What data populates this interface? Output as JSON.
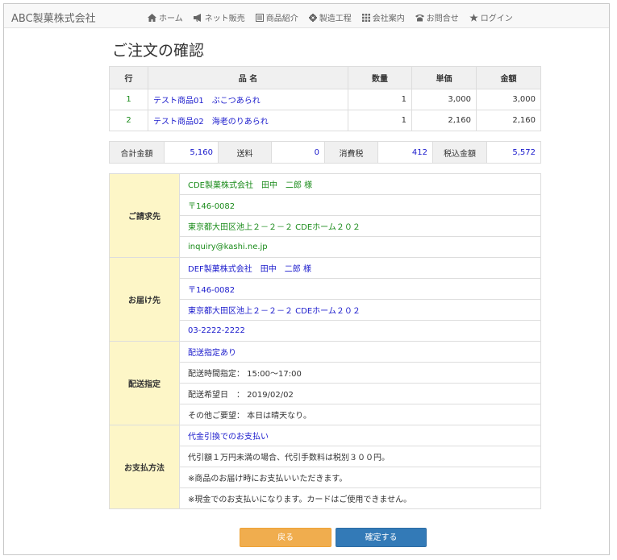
{
  "colors": {
    "accent_blue": "#337ab7",
    "accent_orange": "#f0ad4e",
    "label_bg": "#fdf6c7",
    "green_text": "#1a8b1a",
    "blue_text": "#1a1acc"
  },
  "header": {
    "brand": "ABC製菓株式会社",
    "nav": [
      {
        "icon": "home-icon",
        "label": "ホーム"
      },
      {
        "icon": "bullhorn-icon",
        "label": "ネット販売"
      },
      {
        "icon": "list-icon",
        "label": "商品紹介"
      },
      {
        "icon": "gear-icon",
        "label": "製造工程"
      },
      {
        "icon": "grid-icon",
        "label": "会社案内"
      },
      {
        "icon": "phone-icon",
        "label": "お問合せ"
      },
      {
        "icon": "star-icon",
        "label": "ログイン"
      }
    ]
  },
  "page": {
    "title": "ご注文の確認"
  },
  "items_table": {
    "headers": [
      "行",
      "品 名",
      "数量",
      "単価",
      "金額"
    ],
    "rows": [
      {
        "no": "1",
        "name": "テスト商品01　ぶこつあられ",
        "qty": "1",
        "price": "3,000",
        "amount": "3,000"
      },
      {
        "no": "2",
        "name": "テスト商品02　海老のりあられ",
        "qty": "1",
        "price": "2,160",
        "amount": "2,160"
      }
    ]
  },
  "totals": {
    "subtotal_label": "合計金額",
    "subtotal": "5,160",
    "shipping_label": "送料",
    "shipping": "0",
    "tax_label": "消費税",
    "tax": "412",
    "total_label": "税込金額",
    "total": "5,572"
  },
  "billing": {
    "label": "ご請求先",
    "company": "CDE製菓株式会社　田中　二郎 様",
    "zip": "〒146-0082",
    "address": "東京都大田区池上２－２－２ CDEホーム２０２",
    "email": "inquiry@kashi.ne.jp"
  },
  "delivery": {
    "label": "お届け先",
    "company": "DEF製菓株式会社　田中　二郎 様",
    "zip": "〒146-0082",
    "address": "東京都大田区池上２－２－２ CDEホーム２０２",
    "phone": "03-2222-2222"
  },
  "shipping_spec": {
    "label": "配送指定",
    "status": "配送指定あり",
    "time": "配送時間指定： 15:00～17:00",
    "date": "配送希望日　： 2019/02/02",
    "notes": "その他ご要望： 本日は晴天なり。"
  },
  "payment": {
    "label": "お支払方法",
    "method": "代金引換でのお支払い",
    "line1": "代引額１万円未満の場合、代引手数料は税別３００円。",
    "line2": "※商品のお届け時にお支払いいただきます。",
    "line3": "※現金でのお支払いになります。カードはご使用できません。"
  },
  "buttons": {
    "back": "戻る",
    "confirm": "確定する"
  }
}
